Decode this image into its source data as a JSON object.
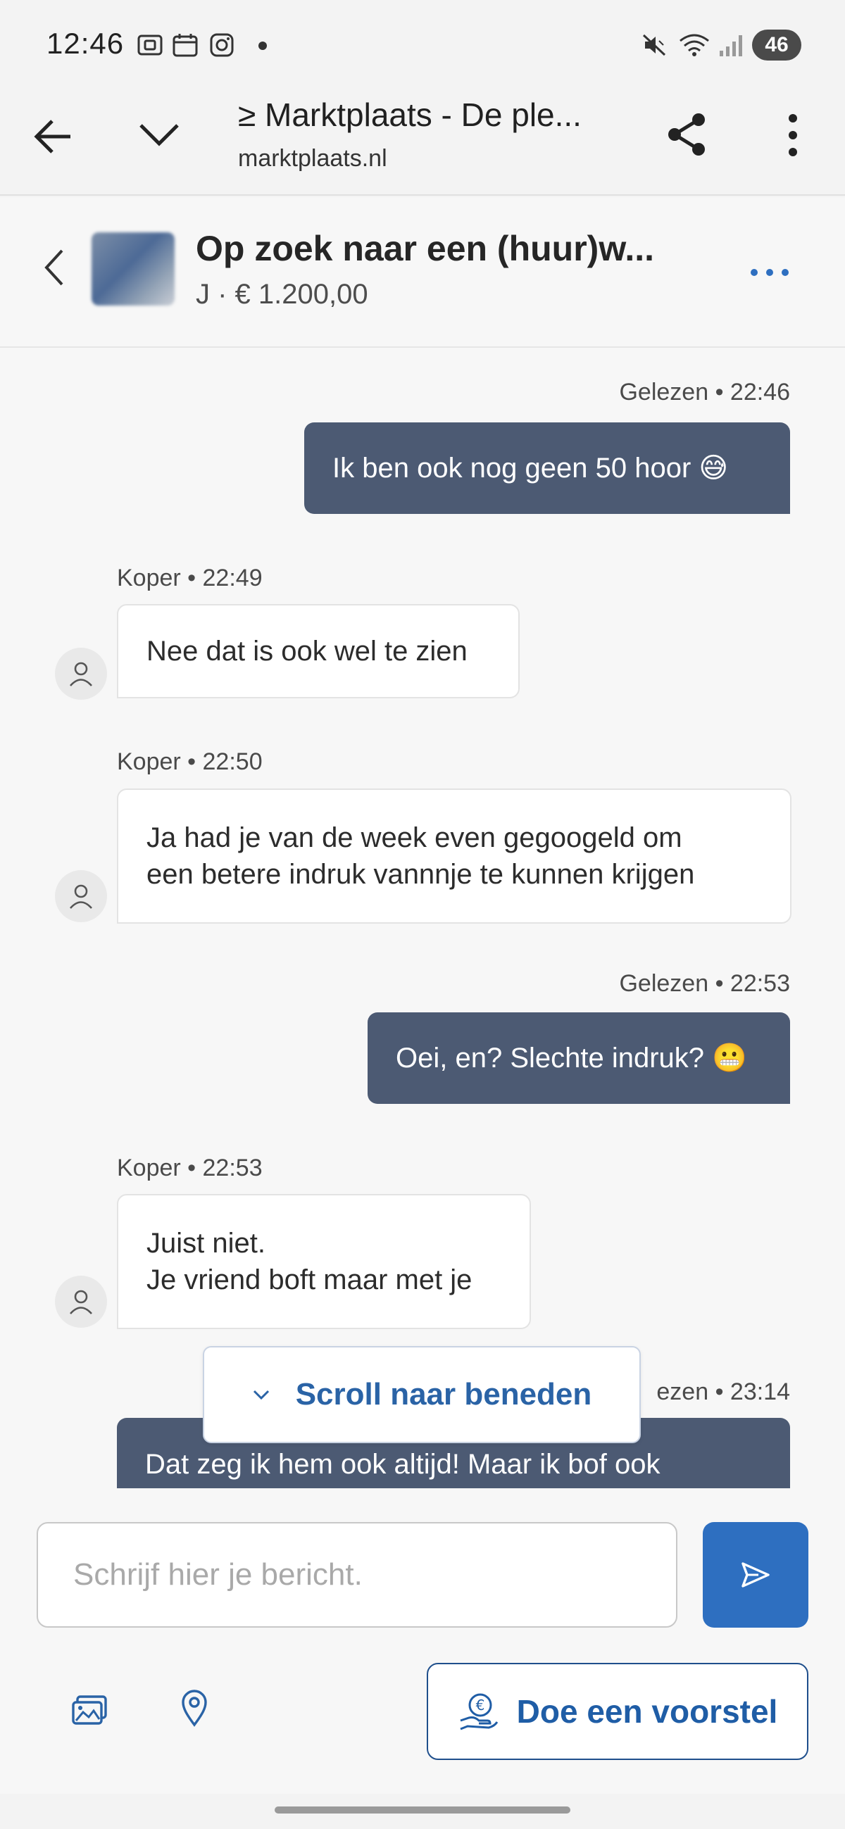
{
  "status_bar": {
    "time": "12:46",
    "battery": "46",
    "icons": [
      "screenshot-icon",
      "calendar-icon",
      "instagram-icon",
      "notification-dot-icon",
      "mute-icon",
      "wifi-icon",
      "signal-icon"
    ]
  },
  "browser": {
    "title": "≥ Marktplaats - De ple...",
    "url": "marktplaats.nl",
    "icons": [
      "back-arrow-icon",
      "chevron-down-icon",
      "share-icon",
      "more-vertical-icon"
    ]
  },
  "conversation": {
    "title": "Op zoek naar een (huur)w...",
    "subtitle": "J · € 1.200,00"
  },
  "messages": [
    {
      "direction": "out",
      "meta": "Gelezen • 22:46",
      "lines": [
        "Ik ben ook nog geen 50 hoor 😅"
      ]
    },
    {
      "direction": "in",
      "meta": "Koper • 22:49",
      "lines": [
        "Nee dat is ook wel te zien"
      ]
    },
    {
      "direction": "in",
      "meta": "Koper • 22:50",
      "lines": [
        "Ja had je van de week even gegoogeld om",
        "een betere indruk vannnje te kunnen krijgen"
      ]
    },
    {
      "direction": "out",
      "meta": "Gelezen • 22:53",
      "lines": [
        "Oei, en? Slechte indruk? 😬"
      ]
    },
    {
      "direction": "in",
      "meta": "Koper • 22:53",
      "lines": [
        "Juist niet.",
        "Je vriend boft maar met je"
      ]
    },
    {
      "direction": "out",
      "meta": "ezen • 23:14",
      "lines": [
        "Dat zeg ik hem ook altijd! Maar ik bof ook"
      ]
    }
  ],
  "scroll_pill": {
    "label": "Scroll naar beneden"
  },
  "composer": {
    "placeholder": "Schrijf hier je bericht.",
    "offer_label": "Doe een voorstel"
  },
  "colors": {
    "accent": "#2e6fc0",
    "outgoing_bubble": "#4c5a73",
    "incoming_bubble": "#ffffff",
    "link": "#2a63a6"
  }
}
